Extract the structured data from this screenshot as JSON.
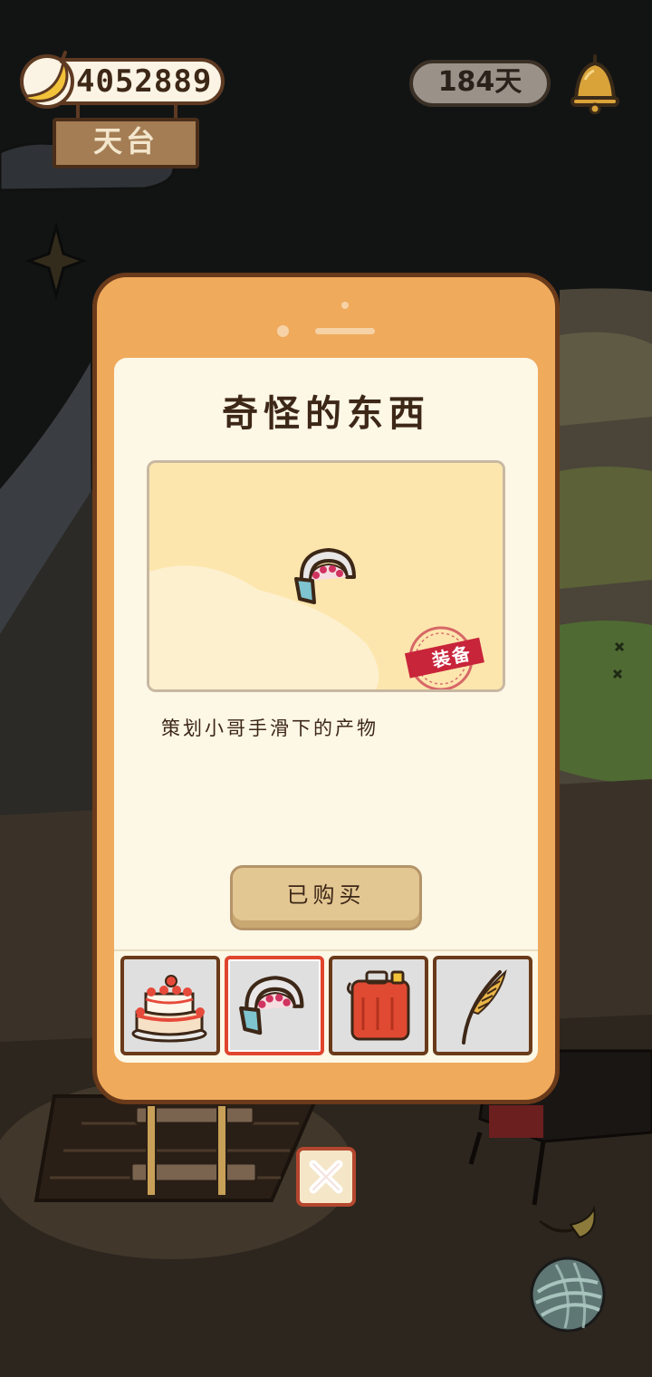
{
  "hud": {
    "coin_count": "4052889",
    "location": "天台",
    "days": "184天"
  },
  "dialog": {
    "title": "奇怪的东西",
    "badge": "装备",
    "description": "策划小哥手滑下的产物",
    "buy_label": "已购买",
    "items": [
      {
        "icon": "cake-icon"
      },
      {
        "icon": "ring-bracelet-icon",
        "selected": true
      },
      {
        "icon": "fuel-can-icon"
      },
      {
        "icon": "wheat-stalk-icon"
      }
    ]
  },
  "colors": {
    "background": "#121414",
    "dialog_frame": "#efaa5c",
    "screen": "#fdf7e6",
    "selected_border": "#e0452e",
    "badge_red": "#c8243a"
  }
}
